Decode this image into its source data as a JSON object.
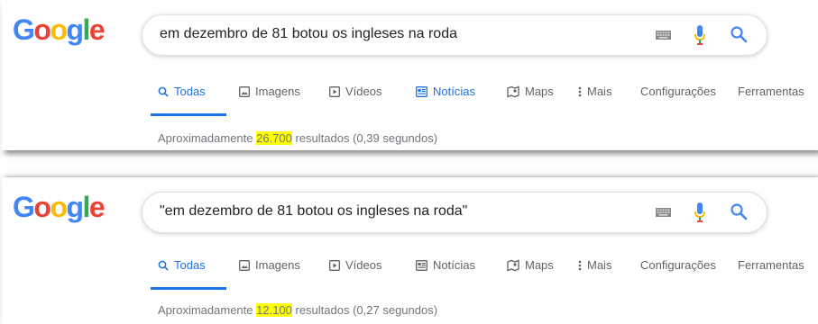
{
  "panels": [
    {
      "logo": "Google",
      "query": "em dezembro de 81 botou os ingleses na roda",
      "tabs": [
        {
          "label": "Todas",
          "icon": "search-icon",
          "active": true
        },
        {
          "label": "Imagens",
          "icon": "image-icon",
          "active": false
        },
        {
          "label": "Vídeos",
          "icon": "video-icon",
          "active": false
        },
        {
          "label": "Notícias",
          "icon": "news-icon",
          "active": true
        },
        {
          "label": "Maps",
          "icon": "map-icon",
          "active": false
        },
        {
          "label": "Mais",
          "icon": "more-vert-icon",
          "active": false
        },
        {
          "label": "Configurações"
        },
        {
          "label": "Ferramentas"
        }
      ],
      "stats": {
        "prefix": "Aproximadamente ",
        "count": "26.700",
        "suffix": " resultados (0,39 segundos)"
      }
    },
    {
      "logo": "Google",
      "query": "\"em dezembro de 81 botou os ingleses na roda\"",
      "tabs": [
        {
          "label": "Todas",
          "icon": "search-icon",
          "active": true
        },
        {
          "label": "Imagens",
          "icon": "image-icon",
          "active": false
        },
        {
          "label": "Vídeos",
          "icon": "video-icon",
          "active": false
        },
        {
          "label": "Notícias",
          "icon": "news-icon",
          "active": false
        },
        {
          "label": "Maps",
          "icon": "map-icon",
          "active": false
        },
        {
          "label": "Mais",
          "icon": "more-vert-icon",
          "active": false
        },
        {
          "label": "Configurações"
        },
        {
          "label": "Ferramentas"
        }
      ],
      "stats": {
        "prefix": "Aproximadamente ",
        "count": "12.100",
        "suffix": " resultados (0,27 segundos)"
      }
    }
  ],
  "colors": {
    "accent": "#1a73e8",
    "highlight": "#ffff00",
    "muted": "#70757a"
  }
}
